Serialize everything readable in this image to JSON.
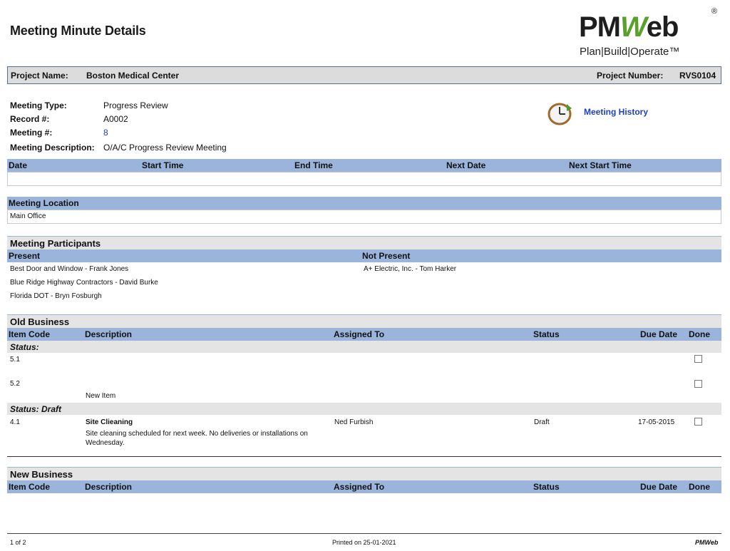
{
  "page": {
    "title": "Meeting Minute Details"
  },
  "logo": {
    "brand_main": "PM",
    "brand_w": "W",
    "brand_tail": "eb",
    "registered": "®",
    "tagline": "Plan|Build|Operate™"
  },
  "project": {
    "name_label": "Project Name:",
    "name": "Boston Medical Center",
    "number_label": "Project Number:",
    "number": "RVS0104"
  },
  "meeting": {
    "type_label": "Meeting Type:",
    "type": "Progress Review",
    "record_label": "Record #:",
    "record": "A0002",
    "number_label": "Meeting #:",
    "number": "8",
    "description_label": "Meeting Description:",
    "description": "O/A/C Progress Review Meeting",
    "history_link": "Meeting History"
  },
  "schedule": {
    "headers": [
      "Date",
      "Start Time",
      "End Time",
      "Next Date",
      "Next Start Time"
    ]
  },
  "location": {
    "header": "Meeting Location",
    "value": "Main Office"
  },
  "participants": {
    "title": "Meeting Participants",
    "present_header": "Present",
    "not_present_header": "Not Present",
    "present": [
      "Best Door and Window - Frank Jones",
      "Blue Ridge Highway Contractors - David  Burke",
      "Florida DOT - Bryn Fosburgh"
    ],
    "not_present": [
      "A+ Electric, Inc. - Tom Harker"
    ]
  },
  "old_business": {
    "title": "Old Business",
    "headers": [
      "Item Code",
      "Description",
      "Assigned To",
      "Status",
      "Due Date",
      "Done"
    ],
    "group1_label": "Status:",
    "rows1": [
      {
        "code": "5.1",
        "desc": ""
      },
      {
        "code": "5.2",
        "desc": "New Item"
      }
    ],
    "group2_label": "Status:  Draft",
    "row_draft": {
      "code": "4.1",
      "title": "Site Clieaning",
      "desc": "Site cleaning scheduled for next week.  No deliveries or installations on Wednesday.",
      "assigned": "Ned Furbish",
      "status": "Draft",
      "due": "17-05-2015"
    }
  },
  "new_business": {
    "title": "New Business",
    "headers": [
      "Item Code",
      "Description",
      "Assigned To",
      "Status",
      "Due Date",
      "Done"
    ]
  },
  "footer": {
    "page": "1 of 2",
    "printed": "Printed on 25-01-2021",
    "brand": "PMWeb"
  },
  "colors": {
    "header_blue": "#9bb4dc",
    "section_gray": "#e4e4e4",
    "link_blue": "#1f3fbf",
    "logo_green": "#5aa02c"
  }
}
